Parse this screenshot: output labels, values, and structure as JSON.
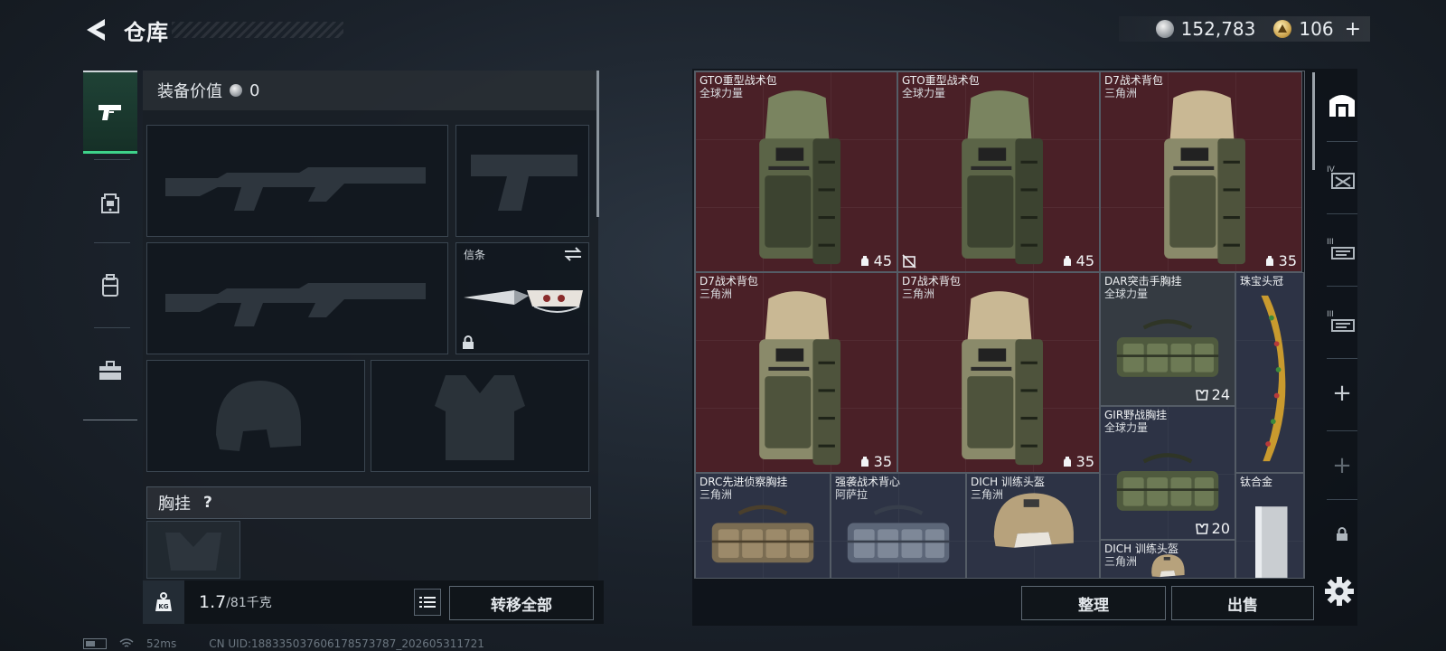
{
  "header": {
    "title": "仓库"
  },
  "currency": {
    "coins": "152,783",
    "premium": "106",
    "add": "+"
  },
  "loadout": {
    "equip_value_label": "装备价值",
    "equip_value": "0",
    "knife_label": "信条",
    "chest_rig_label": "胸挂",
    "chest_rig_help": "?",
    "weight_value": "1.7",
    "weight_max": "/81千克",
    "transfer_all": "转移全部"
  },
  "categories": [
    {
      "name": "weapons",
      "icon": "pistol-icon",
      "active": true
    },
    {
      "name": "armor",
      "icon": "helmet-icon",
      "active": false
    },
    {
      "name": "backpack",
      "icon": "pouch-icon",
      "active": false
    },
    {
      "name": "toolbox",
      "icon": "toolbox-icon",
      "active": false
    }
  ],
  "warehouse": {
    "items": [
      {
        "name": "GTO重型战术包",
        "sub": "全球力量",
        "cap": "45",
        "bg": "red",
        "art": "backpack-olive"
      },
      {
        "name": "GTO重型战术包",
        "sub": "全球力量",
        "cap": "45",
        "bg": "red",
        "art": "backpack-olive"
      },
      {
        "name": "D7战术背包",
        "sub": "三角洲",
        "cap": "35",
        "bg": "red",
        "art": "backpack-tan"
      },
      {
        "name": "D7战术背包",
        "sub": "三角洲",
        "cap": "35",
        "bg": "red",
        "art": "backpack-tan"
      },
      {
        "name": "D7战术背包",
        "sub": "三角洲",
        "cap": "35",
        "bg": "red",
        "art": "backpack-tan"
      },
      {
        "name": "DAR突击手胸挂",
        "sub": "全球力量",
        "cap": "24",
        "bg": "gray",
        "art": "rig-olive"
      },
      {
        "name": "珠宝头冠",
        "sub": "",
        "cap": "",
        "bg": "blue",
        "art": "crown"
      },
      {
        "name": "GIR野战胸挂",
        "sub": "全球力量",
        "cap": "20",
        "bg": "blue",
        "art": "rig-olive"
      },
      {
        "name": "DRC先进侦察胸挂",
        "sub": "三角洲",
        "cap": "",
        "bg": "blue",
        "art": "rig-tan"
      },
      {
        "name": "强袭战术背心",
        "sub": "阿萨拉",
        "cap": "",
        "bg": "blue",
        "art": "rig-gray"
      },
      {
        "name": "DICH 训练头盔",
        "sub": "三角洲",
        "cap": "",
        "bg": "blue",
        "art": "helmet"
      },
      {
        "name": "钛合金",
        "sub": "",
        "cap": "",
        "bg": "blue",
        "art": "ingot"
      },
      {
        "name": "DICH 训练头盔",
        "sub": "三角洲",
        "cap": "",
        "bg": "blue",
        "art": "helmet"
      }
    ],
    "sort": "整理",
    "sell": "出售"
  },
  "status": {
    "ping": "52ms",
    "uid": "CN UID:18833503760617857​3787_202605311721"
  },
  "colors": {
    "accent_green": "#3ed28a",
    "item_red": "#4a2027",
    "item_blue": "#2d3345"
  }
}
